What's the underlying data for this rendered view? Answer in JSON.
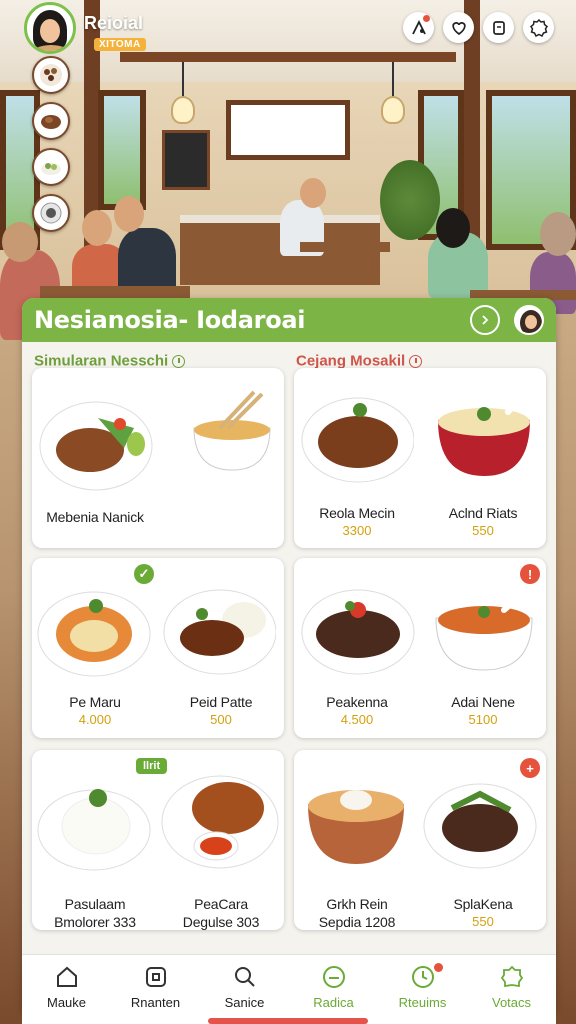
{
  "header": {
    "brand": "Reioial",
    "tag": "XITOMA",
    "icons": [
      "filter-icon",
      "heart-icon",
      "receipt-icon",
      "settings-icon"
    ],
    "rail_icons": [
      "spice-plate-icon",
      "dumpling-icon",
      "herbs-icon",
      "plate-icon"
    ]
  },
  "panel": {
    "title": "Nesianosia- Iodaroai",
    "section_left": "Simularan Nesschi",
    "section_right": "Cejang Mosakil"
  },
  "cards": [
    {
      "items": [
        {
          "name": "Mebenia Nanick",
          "price": ""
        },
        {
          "name": "",
          "price": ""
        }
      ]
    },
    {
      "items": [
        {
          "name": "Reola Mecin",
          "price": "3300"
        },
        {
          "name": "Aclnd Riats",
          "price": "550"
        }
      ]
    },
    {
      "items": [
        {
          "name": "Pe Maru",
          "price": "4.000"
        },
        {
          "name": "Peid Patte",
          "price": "500"
        }
      ]
    },
    {
      "items": [
        {
          "name": "Peakenna",
          "price": "4.500"
        },
        {
          "name": "Adai Nene",
          "price": "5100"
        }
      ]
    },
    {
      "items": [
        {
          "name": "Pasulaam",
          "price": "Bmolorer 333"
        },
        {
          "name": "PeaCara",
          "price": "Degulse 303"
        }
      ]
    },
    {
      "items": [
        {
          "name": "Grkh Rein",
          "price": "Sepdia 1208"
        },
        {
          "name": "SplaKena",
          "price": "550"
        }
      ]
    }
  ],
  "card_pill": "llrit",
  "bottom_nav": [
    {
      "label": "Mauke",
      "icon": "home-icon"
    },
    {
      "label": "Rnanten",
      "icon": "square-icon"
    },
    {
      "label": "Sanice",
      "icon": "search-icon"
    },
    {
      "label": "Radica",
      "icon": "smile-icon"
    },
    {
      "label": "Rteuims",
      "icon": "clock-icon"
    },
    {
      "label": "Votacs",
      "icon": "badge-icon"
    }
  ],
  "colors": {
    "accent": "#7cb545",
    "price": "#d4a10e",
    "alert": "#e5533c",
    "section_right": "#d0544a"
  }
}
